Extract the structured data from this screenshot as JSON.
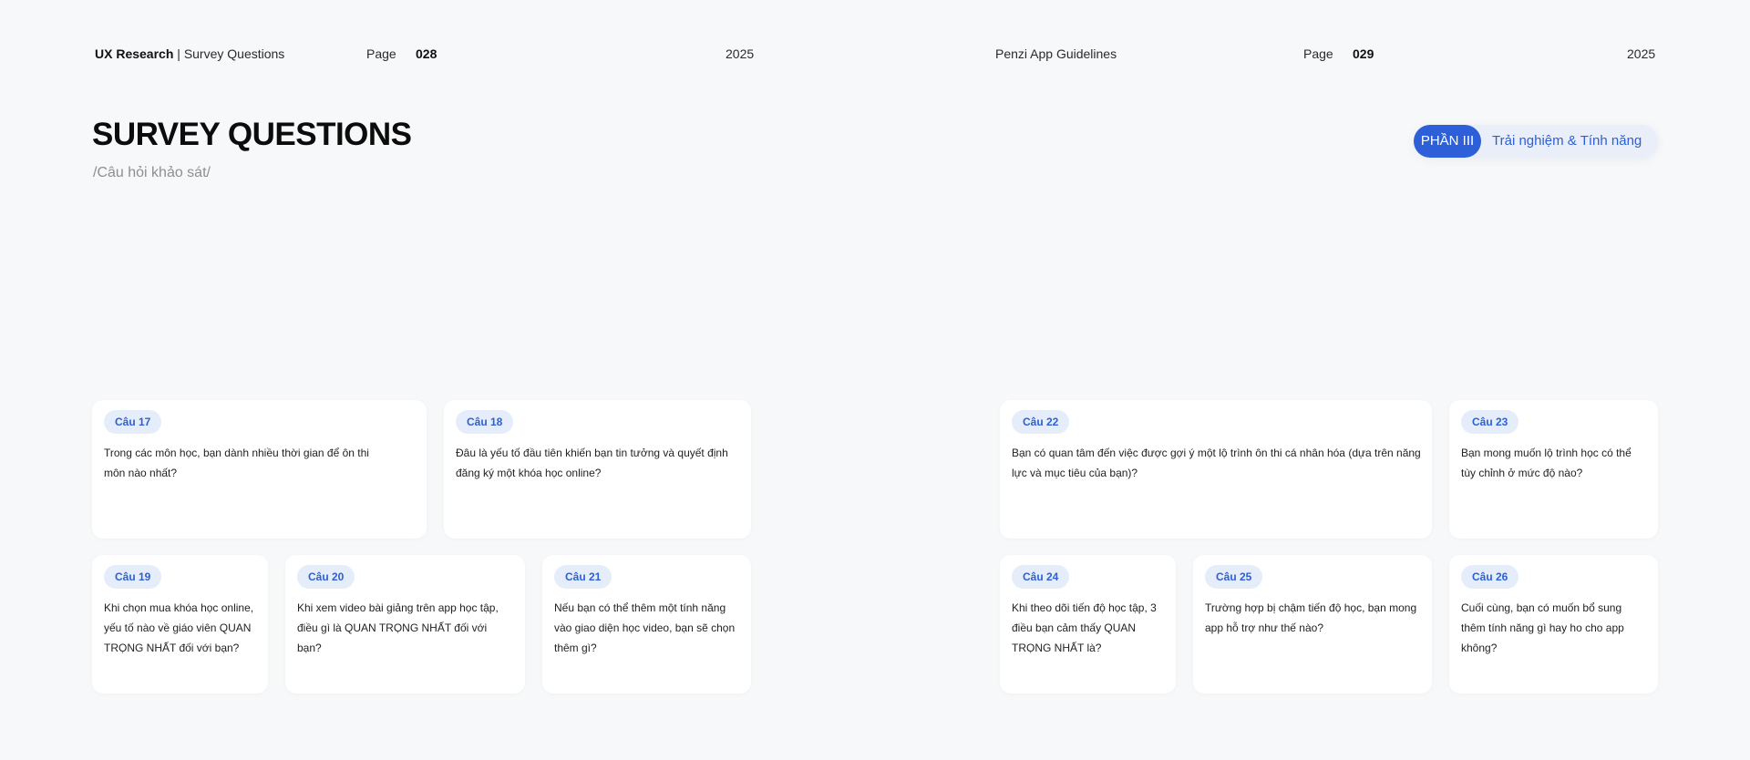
{
  "header_left": {
    "brand": "UX Research",
    "separator": " | ",
    "section": "Survey Questions",
    "page_label": "Page",
    "page_number": "028",
    "year": "2025"
  },
  "header_right": {
    "title": "Penzi App Guidelines",
    "page_label": "Page",
    "page_number": "029",
    "year": "2025"
  },
  "heading": {
    "title": "SURVEY QUESTIONS",
    "subtitle": "/Câu hỏi khảo sát/"
  },
  "section_pill": {
    "label": "PHẦN III",
    "text": "Trải nghiệm & Tính năng",
    "accent_color": "#2c5fd8"
  },
  "questions": [
    {
      "label": "Câu 17",
      "text": "Trong các môn học, bạn dành nhiều thời gian để ôn thi môn nào nhất?"
    },
    {
      "label": "Câu 18",
      "text": "Đâu là yếu tố đầu tiên khiến bạn tin tưởng và quyết định đăng ký một khóa học online?"
    },
    {
      "label": "Câu 19",
      "text": "Khi chọn mua khóa học online, yếu tố nào về giáo viên QUAN TRỌNG NHẤT đối với bạn?"
    },
    {
      "label": "Câu 20",
      "text": "Khi xem video bài giảng trên app học tập, điều gì là QUAN TRỌNG NHẤT đối với bạn?"
    },
    {
      "label": "Câu 21",
      "text": "Nếu bạn có thể thêm một tính năng vào giao diện học video, bạn sẽ chọn thêm gì?"
    },
    {
      "label": "Câu 22",
      "text": "Bạn có quan tâm đến việc được gợi ý một lộ trình ôn thi cá nhân hóa (dựa trên năng lực và mục tiêu của bạn)?"
    },
    {
      "label": "Câu 23",
      "text": "Bạn mong muốn lộ trình học có thể tùy chỉnh ở mức độ nào?"
    },
    {
      "label": "Câu 24",
      "text": "Khi theo dõi tiến độ học tập, 3 điều bạn cảm thấy QUAN TRỌNG NHẤT là?"
    },
    {
      "label": "Câu 25",
      "text": " Trường hợp bị chậm tiến độ học, bạn mong app hỗ trợ như thế nào?"
    },
    {
      "label": "Câu 26",
      "text": "Cuối cùng, bạn có muốn bổ sung thêm tính năng gì hay ho cho app không?"
    }
  ]
}
